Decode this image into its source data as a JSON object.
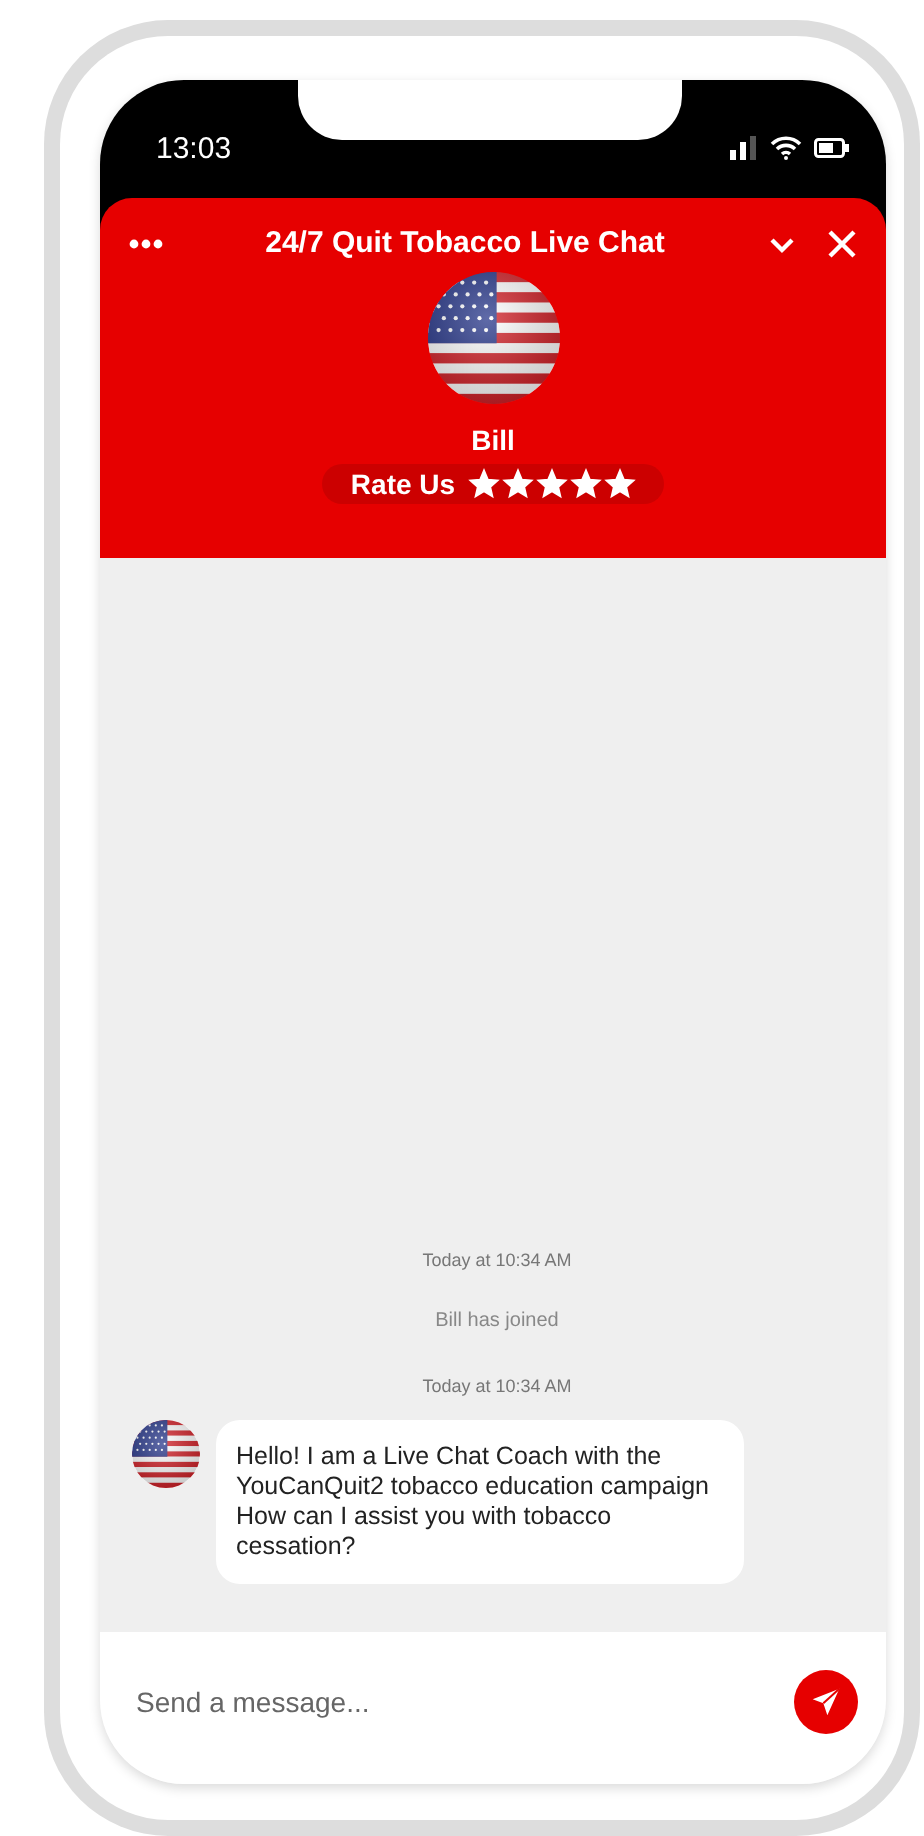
{
  "status_bar": {
    "time": "13:03"
  },
  "header": {
    "title": "24/7 Quit Tobacco Live Chat",
    "agent_name": "Bill",
    "rate_label": "Rate Us",
    "stars": 5
  },
  "messages": [
    {
      "kind": "timestamp",
      "text": "Today at 10:34 AM"
    },
    {
      "kind": "event",
      "text": "Bill has joined"
    },
    {
      "kind": "timestamp",
      "text": "Today at 10:34 AM"
    },
    {
      "kind": "bubble",
      "text": "Hello! I am a Live Chat Coach with the YouCanQuit2 tobacco education campaign How can I assist you with tobacco cessation?"
    }
  ],
  "composer": {
    "placeholder": "Send a message..."
  }
}
